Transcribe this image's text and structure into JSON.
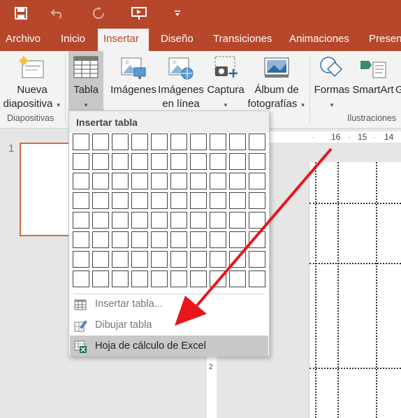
{
  "quick_access": {
    "save": "save-icon",
    "undo": "undo-icon",
    "redo": "redo-icon",
    "present": "present-from-beginning-icon",
    "more": "customize-quick-access-icon"
  },
  "tabs": [
    {
      "label": "Archivo"
    },
    {
      "label": "Inicio"
    },
    {
      "label": "Insertar"
    },
    {
      "label": "Diseño"
    },
    {
      "label": "Transiciones"
    },
    {
      "label": "Animaciones"
    },
    {
      "label": "Present"
    }
  ],
  "ribbon": {
    "nueva_1": "Nueva",
    "nueva_2": "diapositiva",
    "tabla": "Tabla",
    "imagenes": "Imágenes",
    "imagenes_linea_1": "Imágenes",
    "imagenes_linea_2": "en línea",
    "captura": "Captura",
    "album_1": "Álbum de",
    "album_2": "fotografías",
    "formas": "Formas",
    "smartart": "SmartArt",
    "grafico_partial": "G",
    "group_diapositivas": "Diapositivas",
    "group_ilustraciones": "Ilustraciones"
  },
  "slide_panel": {
    "number": "1"
  },
  "ruler": {
    "t1": "16",
    "t2": "15",
    "t3": "14",
    "v1": "2"
  },
  "menu": {
    "title": "Insertar tabla",
    "items": [
      {
        "label": "Insertar tabla..."
      },
      {
        "label": "Dibujar tabla"
      },
      {
        "label": "Hoja de cálculo de Excel"
      }
    ]
  },
  "colors": {
    "accent": "#b7472a",
    "annotation_arrow": "#e8161b"
  }
}
